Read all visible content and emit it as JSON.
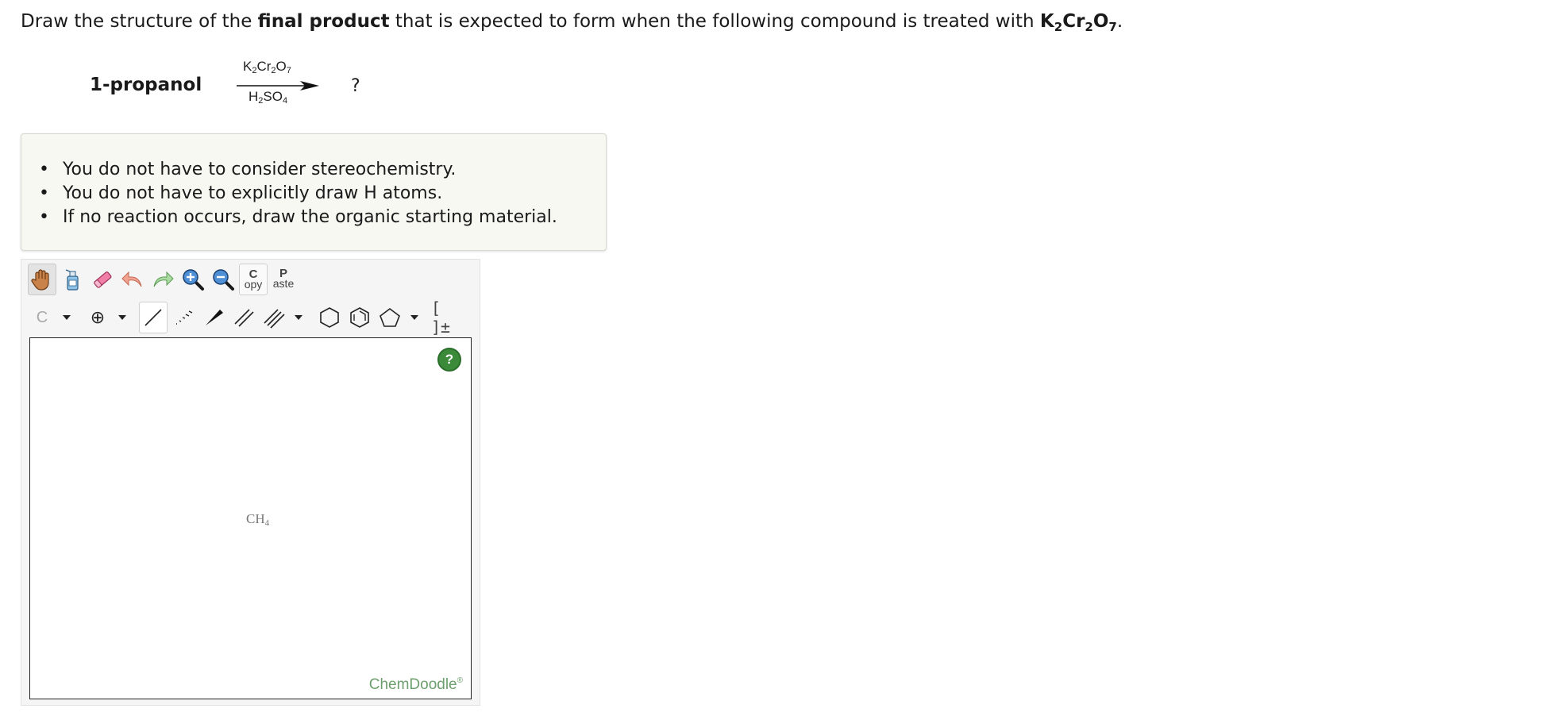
{
  "question": {
    "prefix": "Draw the structure of the ",
    "emphasis": "final product",
    "middle": " that is expected to form when the following compound is treated with ",
    "reagent_main": "K",
    "reagent_sub1": "2",
    "reagent_mid": "Cr",
    "reagent_sub2": "2",
    "reagent_o": "O",
    "reagent_sub3": "7",
    "suffix": "."
  },
  "reaction": {
    "reactant": "1-propanol",
    "reagent_top": {
      "a": "K",
      "a_sub": "2",
      "b": "Cr",
      "b_sub": "2",
      "c": "O",
      "c_sub": "7"
    },
    "reagent_bottom": {
      "a": "H",
      "a_sub": "2",
      "b": "SO",
      "b_sub": "4"
    },
    "product": "?"
  },
  "notes": [
    "You do not have to consider stereochemistry.",
    "You do not have to explicitly draw H atoms.",
    "If no reaction occurs, draw the organic starting material."
  ],
  "editor": {
    "toolbar1": [
      "hand-icon",
      "eraser-bottle-icon",
      "eraser-icon",
      "undo-icon",
      "redo-icon",
      "zoom-in-icon",
      "zoom-out-icon"
    ],
    "copy": {
      "top": "C",
      "bottom": "opy"
    },
    "paste": {
      "top": "P",
      "bottom": "aste"
    },
    "atom_label": "C",
    "charge_symbol": "⊕",
    "brackets": "[ ]±",
    "canvas": {
      "molecule": {
        "base": "CH",
        "sub": "4"
      },
      "help": "?",
      "brand": "ChemDoodle",
      "brand_mark": "®"
    }
  }
}
